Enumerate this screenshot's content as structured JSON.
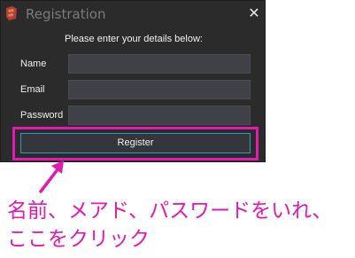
{
  "window": {
    "title": "Registration",
    "close_glyph": "✕"
  },
  "form": {
    "prompt": "Please enter your details below:",
    "fields": [
      {
        "label": "Name",
        "value": "",
        "placeholder": ""
      },
      {
        "label": "Email",
        "value": "",
        "placeholder": ""
      },
      {
        "label": "Password",
        "value": "",
        "placeholder": ""
      }
    ],
    "submit_label": "Register"
  },
  "annotation": {
    "line1": "名前、メアド、パスワードをいれ、",
    "line2": "ここをクリック",
    "color": "#e21ab0"
  },
  "colors": {
    "dialog_bg": "#2b2b2b",
    "input_bg": "#3f4147",
    "button_border": "#2d9bc2",
    "highlight": "#e21ab0"
  },
  "icons": {
    "app": "app-logo-icon",
    "close": "close-icon",
    "arrow": "annotation-arrow"
  }
}
